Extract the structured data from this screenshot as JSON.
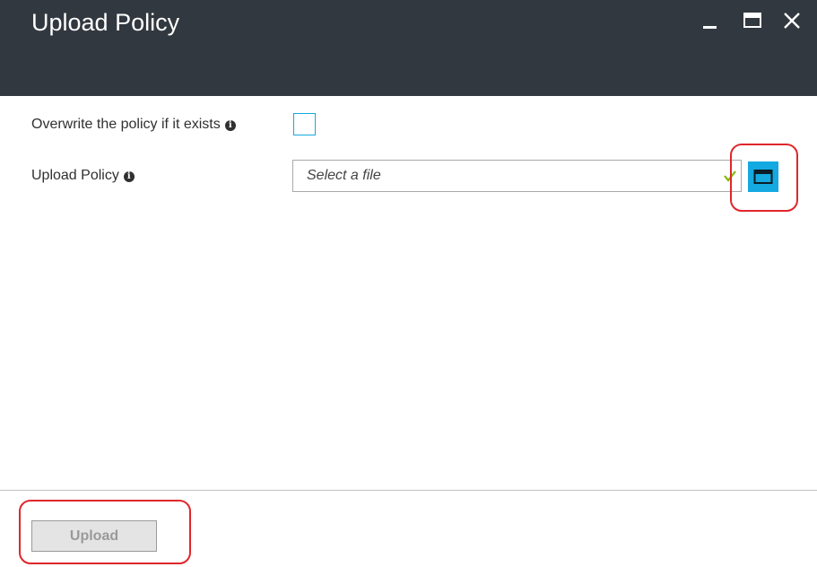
{
  "window": {
    "title": "Upload Policy",
    "controls": [
      {
        "name": "minimize",
        "icon": "minimize-icon"
      },
      {
        "name": "maximize",
        "icon": "maximize-icon"
      },
      {
        "name": "close",
        "icon": "close-icon"
      }
    ]
  },
  "form": {
    "overwrite_label": "Overwrite the policy if it exists",
    "overwrite_checked": false,
    "upload_label": "Upload Policy",
    "file_select_placeholder": "Select a file",
    "info_icon": "info-icon",
    "valid_icon": "checkmark-icon",
    "browse_icon": "folder-icon"
  },
  "footer": {
    "upload_button_label": "Upload",
    "upload_button_disabled": true
  },
  "colors": {
    "header_bg": "#32383f",
    "accent": "#14a9e0",
    "valid_check": "#7fba00",
    "annotation": "#e0262b"
  }
}
